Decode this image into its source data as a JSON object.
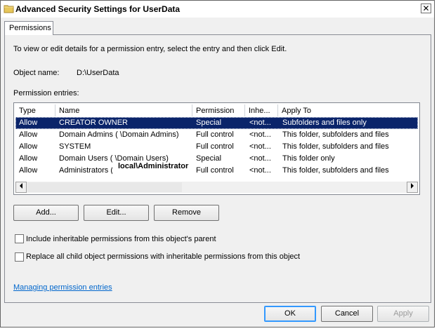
{
  "window": {
    "title": "Advanced Security Settings for UserData",
    "close_glyph": "✕"
  },
  "tabs": [
    {
      "label": "Permissions"
    }
  ],
  "instructions": "To view or edit details for a permission entry, select the entry and then click Edit.",
  "object": {
    "label": "Object name:",
    "value": "D:\\UserData"
  },
  "entries": {
    "label": "Permission entries:",
    "columns": [
      "Type",
      "Name",
      "Permission",
      "Inhe...",
      "Apply To"
    ],
    "rows": [
      {
        "type": "Allow",
        "name": "CREATOR OWNER",
        "permission": "Special",
        "inherited": "<not...",
        "apply_to": "Subfolders and files only"
      },
      {
        "type": "Allow",
        "name": "Domain Admins (         \\Domain Admins)",
        "permission": "Full control",
        "inherited": "<not...",
        "apply_to": "This folder, subfolders and files"
      },
      {
        "type": "Allow",
        "name": "SYSTEM",
        "permission": "Full control",
        "inherited": "<not...",
        "apply_to": "This folder, subfolders and files"
      },
      {
        "type": "Allow",
        "name": "Domain Users (         \\Domain Users)",
        "permission": "Special",
        "inherited": "<not...",
        "apply_to": "This folder only"
      },
      {
        "type": "Allow",
        "name": "Administrators (",
        "permission": "Full control",
        "inherited": "<not...",
        "apply_to": "This folder, subfolders and files"
      }
    ],
    "redaction_overlay": "local\\Administrator"
  },
  "buttons": {
    "add": "Add...",
    "edit": "Edit...",
    "remove": "Remove",
    "ok": "OK",
    "cancel": "Cancel",
    "apply": "Apply"
  },
  "checkboxes": {
    "include_inheritable": "Include inheritable permissions from this object's parent",
    "replace_child": "Replace all child object permissions with inheritable permissions from this object"
  },
  "link": "Managing permission entries",
  "colors": {
    "selection": "#0a246a",
    "link": "#0066cc",
    "dialog_bg": "#f0f0f0",
    "default_button_border": "#3399ff"
  }
}
